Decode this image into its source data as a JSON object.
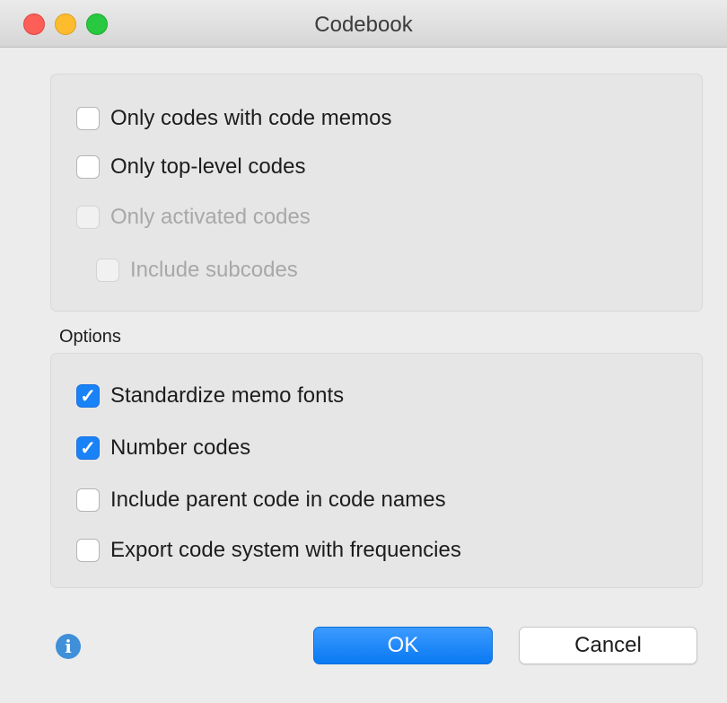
{
  "window": {
    "title": "Codebook",
    "traffic_lights": [
      "close",
      "minimize",
      "zoom"
    ]
  },
  "filters": {
    "items": [
      {
        "label": "Only codes with code memos",
        "checked": false,
        "enabled": true
      },
      {
        "label": "Only top-level codes",
        "checked": false,
        "enabled": true
      },
      {
        "label": "Only activated codes",
        "checked": false,
        "enabled": false
      },
      {
        "label": "Include subcodes",
        "checked": false,
        "enabled": false
      }
    ]
  },
  "options": {
    "heading": "Options",
    "items": [
      {
        "label": "Standardize memo fonts",
        "checked": true,
        "enabled": true
      },
      {
        "label": "Number codes",
        "checked": true,
        "enabled": true
      },
      {
        "label": "Include parent code in code names",
        "checked": false,
        "enabled": true
      },
      {
        "label": "Export code system with frequencies",
        "checked": false,
        "enabled": true
      }
    ]
  },
  "footer": {
    "info_icon": "info-icon",
    "ok_label": "OK",
    "cancel_label": "Cancel"
  },
  "colors": {
    "accent": "#1a82f7",
    "info": "#3f8fd9"
  }
}
